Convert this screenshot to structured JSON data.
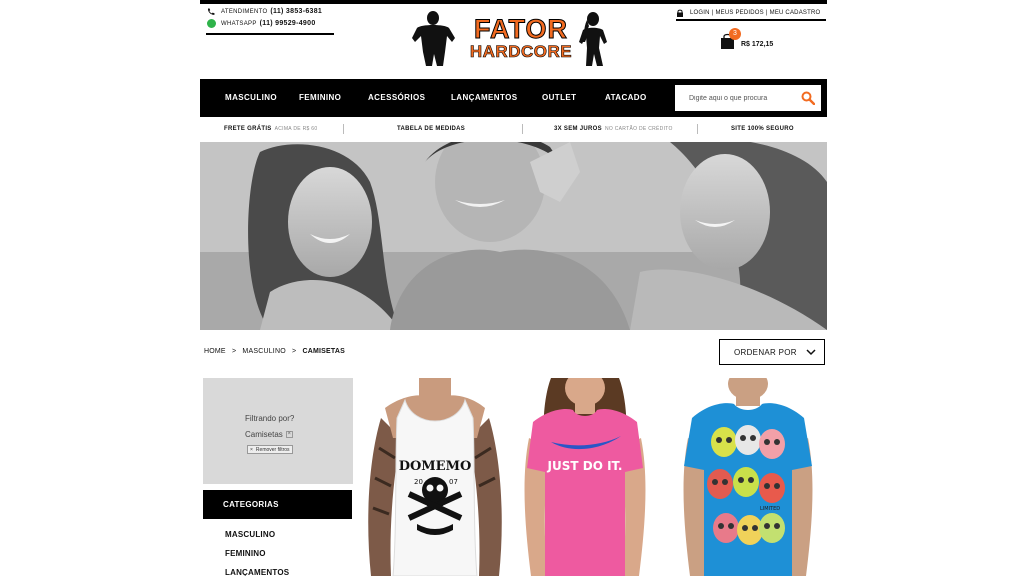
{
  "contact": {
    "phone_label": "ATENDIMENTO",
    "phone_number": "(11) 3853-6381",
    "whatsapp_label": "WHATSAPP",
    "whatsapp_number": "(11) 99529-4900"
  },
  "brand": {
    "line1": "FATOR",
    "line2": "HARDCORE"
  },
  "account": {
    "login": "LOGIN",
    "orders": "MEUS PEDIDOS",
    "register": "MEU CADASTRO",
    "separator": "|"
  },
  "cart": {
    "count": "3",
    "total": "R$ 172,15"
  },
  "nav": {
    "items": [
      "MASCULINO",
      "FEMININO",
      "ACESSÓRIOS",
      "LANÇAMENTOS",
      "OUTLET",
      "ATACADO"
    ],
    "search_placeholder": "Digite aqui o que procura"
  },
  "info_bar": {
    "free_shipping": "FRETE GRÁTIS",
    "free_shipping_note": "ACIMA DE R$ 60",
    "size_table": "TABELA DE MEDIDAS",
    "installments": "3X SEM JUROS",
    "installments_note": "NO CARTÃO DE CRÉDITO",
    "secure_site": "SITE 100% SEGURO"
  },
  "breadcrumb": {
    "home": "HOME",
    "section": "MASCULINO",
    "current": "CAMISETAS",
    "separator": ">"
  },
  "sort": {
    "label": "ORDENAR POR"
  },
  "filters": {
    "title": "Filtrando por?",
    "active_filter": "Camisetas",
    "remove_label": "Remover filtros"
  },
  "categories": {
    "header": "CATEGORIAS",
    "items": [
      "MASCULINO",
      "FEMININO",
      "LANÇAMENTOS"
    ]
  },
  "products": {
    "p1_print_line": "DOMEMO",
    "p1_print_year_left": "20",
    "p1_print_year_right": "07",
    "p2_print": "JUST DO IT.",
    "p3_print": "LIMITED"
  },
  "colors": {
    "accent_orange": "#f26b21",
    "nav_black": "#000000",
    "filter_bg": "#d9d9d9",
    "whatsapp_green": "#2fb34a",
    "pink_shirt": "#ee5aa0",
    "blue_shirt": "#1e90d6"
  },
  "icons": [
    "phone-icon",
    "whatsapp-icon",
    "lock-icon",
    "shopping-bag-icon",
    "search-icon",
    "chevron-down-icon",
    "close-icon"
  ]
}
